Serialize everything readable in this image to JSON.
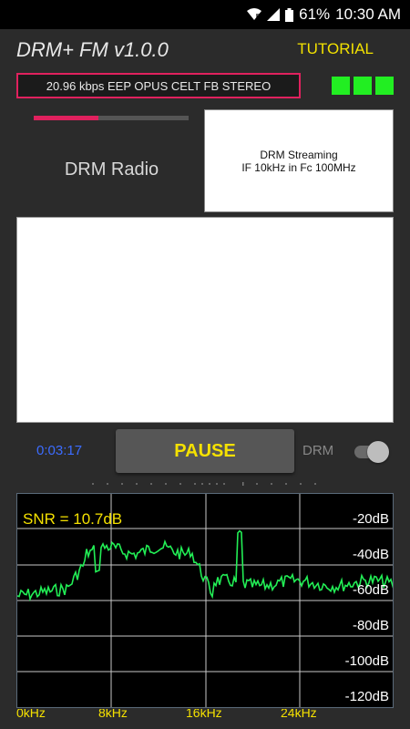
{
  "status_bar": {
    "battery": "61%",
    "time": "10:30 AM"
  },
  "app": {
    "title": "DRM+ FM v1.0.0",
    "tutorial_label": "TUTORIAL"
  },
  "stream_info": "20.96 kbps EEP OPUS CELT FB STEREO",
  "signal_progress": 0.42,
  "station_label": "DRM Radio",
  "info_panel": {
    "line1": "DRM Streaming",
    "line2": "IF 10kHz in Fc 100MHz"
  },
  "playback": {
    "time": "0:03:17",
    "pause_label": "PAUSE",
    "drm_label": "DRM"
  },
  "spectrum": {
    "snr": "SNR = 10.7dB",
    "db_labels": [
      "-20dB",
      "-40dB",
      "-60dB",
      "-80dB",
      "-100dB",
      "-120dB"
    ],
    "freq_labels": [
      "0kHz",
      "8kHz",
      "16kHz",
      "24kHz"
    ]
  },
  "colors": {
    "accent": "#e0215e",
    "led": "#22ee22",
    "highlight": "#f5e100",
    "trace": "#22ee55",
    "time": "#3c6cff"
  }
}
